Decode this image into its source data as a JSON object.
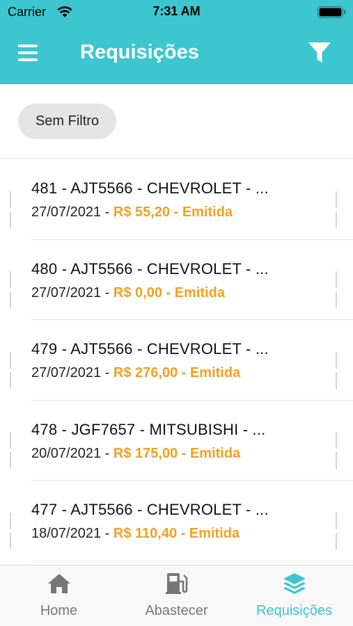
{
  "status_bar": {
    "carrier": "Carrier",
    "time": "7:31 AM"
  },
  "header": {
    "title": "Requisições"
  },
  "filter": {
    "chip_label": "Sem Filtro"
  },
  "requisitions": [
    {
      "title": "481 - AJT5566 - CHEVROLET - ...",
      "date": "27/07/2021",
      "value": "R$ 55,20",
      "status": "Emitida"
    },
    {
      "title": "480 - AJT5566 - CHEVROLET - ...",
      "date": "27/07/2021",
      "value": "R$ 0,00",
      "status": "Emitida"
    },
    {
      "title": "479 - AJT5566 - CHEVROLET - ...",
      "date": "27/07/2021",
      "value": "R$ 276,00",
      "status": "Emitida"
    },
    {
      "title": "478 - JGF7657 - MITSUBISHI - ...",
      "date": "20/07/2021",
      "value": "R$ 175,00",
      "status": "Emitida"
    },
    {
      "title": "477 - AJT5566 - CHEVROLET - ...",
      "date": "18/07/2021",
      "value": "R$ 110,40",
      "status": "Emitida"
    }
  ],
  "tabs": [
    {
      "label": "Home",
      "icon": "home-icon",
      "active": false
    },
    {
      "label": "Abastecer",
      "icon": "fuel-pump-icon",
      "active": false
    },
    {
      "label": "Requisições",
      "icon": "layers-icon",
      "active": true
    }
  ],
  "colors": {
    "accent": "#3cc6cf",
    "value_highlight": "#f0a021",
    "inactive_tab": "#777777"
  }
}
